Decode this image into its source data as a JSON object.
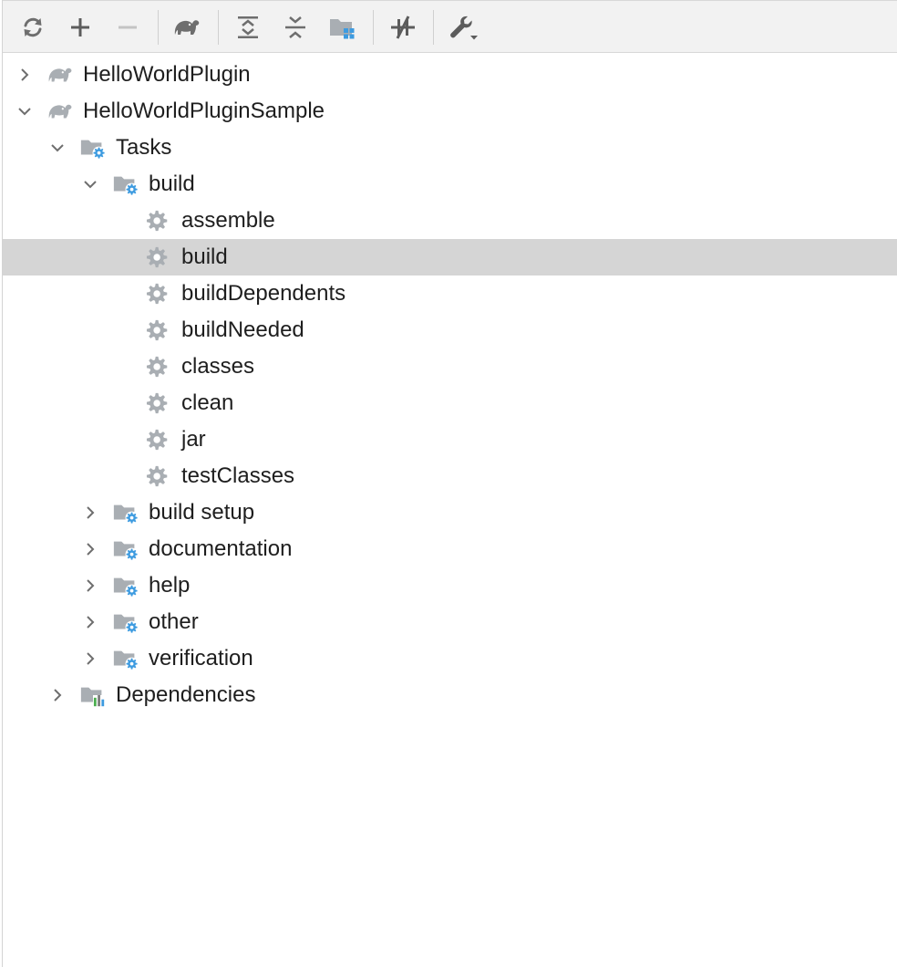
{
  "toolbar": {
    "buttons": [
      {
        "name": "reload-all-projects",
        "icon": "refresh-icon"
      },
      {
        "name": "add-project",
        "icon": "plus-icon"
      },
      {
        "name": "remove-project",
        "icon": "minus-icon",
        "disabled": true
      },
      {
        "name": "execute-gradle-task",
        "icon": "elephant-icon"
      },
      {
        "name": "expand-all",
        "icon": "expand-all-icon"
      },
      {
        "name": "collapse-all",
        "icon": "collapse-all-icon"
      },
      {
        "name": "group-modules",
        "icon": "folder-grid-icon"
      },
      {
        "name": "toggle-offline-mode",
        "icon": "offline-icon"
      },
      {
        "name": "build-tool-settings",
        "icon": "wrench-icon"
      }
    ]
  },
  "tree": {
    "selected_index": 5,
    "items": [
      {
        "label": "HelloWorldPlugin",
        "level": 0,
        "type": "project",
        "expanded": false
      },
      {
        "label": "HelloWorldPluginSample",
        "level": 0,
        "type": "project",
        "expanded": true
      },
      {
        "label": "Tasks",
        "level": 1,
        "type": "task-folder",
        "expanded": true
      },
      {
        "label": "build",
        "level": 2,
        "type": "task-folder",
        "expanded": true
      },
      {
        "label": "assemble",
        "level": 3,
        "type": "task"
      },
      {
        "label": "build",
        "level": 3,
        "type": "task"
      },
      {
        "label": "buildDependents",
        "level": 3,
        "type": "task"
      },
      {
        "label": "buildNeeded",
        "level": 3,
        "type": "task"
      },
      {
        "label": "classes",
        "level": 3,
        "type": "task"
      },
      {
        "label": "clean",
        "level": 3,
        "type": "task"
      },
      {
        "label": "jar",
        "level": 3,
        "type": "task"
      },
      {
        "label": "testClasses",
        "level": 3,
        "type": "task"
      },
      {
        "label": "build setup",
        "level": 2,
        "type": "task-folder",
        "expanded": false
      },
      {
        "label": "documentation",
        "level": 2,
        "type": "task-folder",
        "expanded": false
      },
      {
        "label": "help",
        "level": 2,
        "type": "task-folder",
        "expanded": false
      },
      {
        "label": "other",
        "level": 2,
        "type": "task-folder",
        "expanded": false
      },
      {
        "label": "verification",
        "level": 2,
        "type": "task-folder",
        "expanded": false
      },
      {
        "label": "Dependencies",
        "level": 1,
        "type": "dependencies",
        "expanded": false
      }
    ]
  },
  "colors": {
    "icon_gray": "#7d7d7d",
    "icon_light_gray": "#a9aeb3",
    "gear_blue": "#3d9be0",
    "selection": "#d5d5d5"
  }
}
